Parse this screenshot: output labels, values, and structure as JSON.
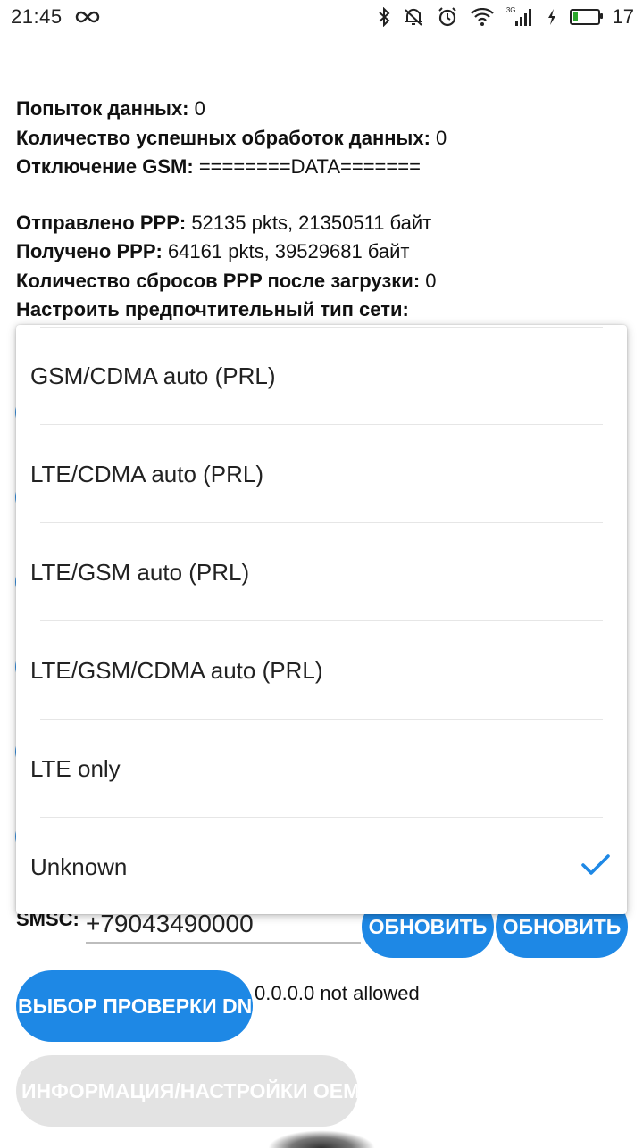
{
  "status_bar": {
    "time": "21:45",
    "battery_level": "17",
    "net_tag": "3G",
    "icons": [
      "infinity-icon",
      "bluetooth-icon",
      "mute-icon",
      "alarm-icon",
      "wifi-icon",
      "signal-icon",
      "charging-icon",
      "battery-icon"
    ]
  },
  "info": {
    "lines1": [
      {
        "label": "Попыток данных:",
        "value": " 0"
      },
      {
        "label": "Количество успешных обработок данных:",
        "value": " 0"
      },
      {
        "label": "Отключение GSM:",
        "value": " ========DATA======="
      }
    ],
    "lines2": [
      {
        "label": "Отправлено PPP:",
        "value": " 52135 pkts, 21350511 байт"
      },
      {
        "label": "Получено PPP:",
        "value": " 64161 pkts, 39529681 байт"
      },
      {
        "label": "Количество сбросов PPP после загрузки:",
        "value": " 0"
      },
      {
        "label": "Настроить предпочтительный тип сети:",
        "value": ""
      }
    ]
  },
  "network_type_popup": {
    "options": [
      {
        "label": "GSM/CDMA auto (PRL)",
        "selected": false
      },
      {
        "label": "LTE/CDMA auto (PRL)",
        "selected": false
      },
      {
        "label": "LTE/GSM auto (PRL)",
        "selected": false
      },
      {
        "label": "LTE/GSM/CDMA auto (PRL)",
        "selected": false
      },
      {
        "label": "LTE only",
        "selected": false
      },
      {
        "label": "Unknown",
        "selected": true
      }
    ]
  },
  "smsc": {
    "label": "SMSC:",
    "value": "+79043490000",
    "update_label_1": "ОБНОВИТЬ",
    "update_label_2": "ОБНОВИТЬ"
  },
  "dns": {
    "button_label": "ВЫБОР ПРОВЕРКИ DNS",
    "status": "0.0.0.0 not allowed"
  },
  "oem": {
    "button_label": "ИНФОРМАЦИЯ/НАСТРОЙКИ OEM"
  },
  "colors": {
    "accent": "#1e88e5",
    "disabled": "#e3e3e3",
    "battery_fill": "#2aa52a"
  }
}
